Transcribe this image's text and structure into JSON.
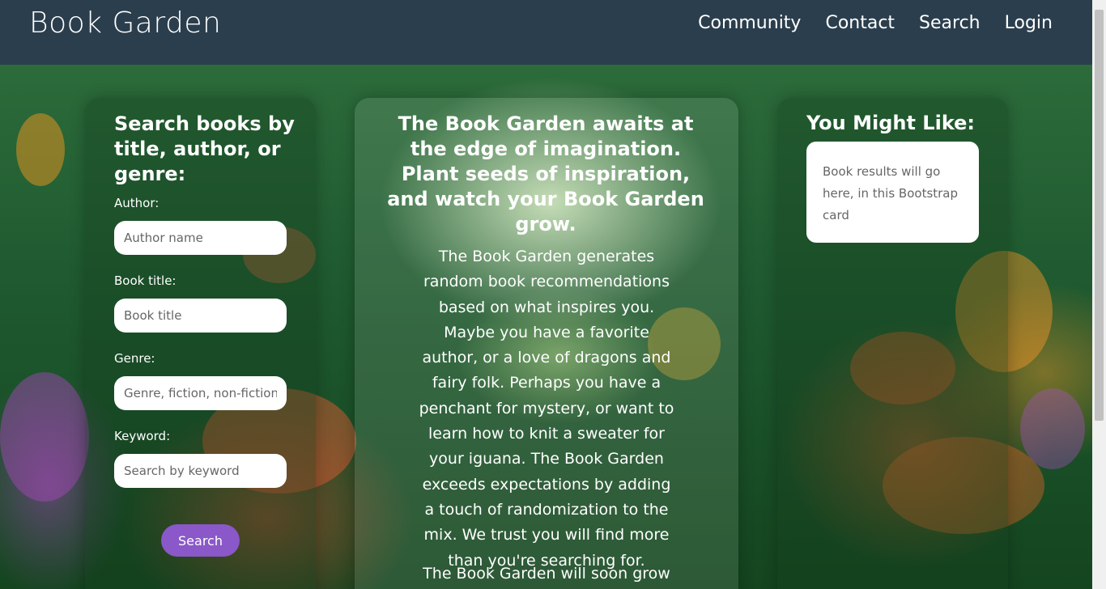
{
  "navbar": {
    "brand": "Book Garden",
    "links": [
      "Community",
      "Contact",
      "Search",
      "Login"
    ]
  },
  "search_form": {
    "title": "Search books by title, author, or genre:",
    "fields": [
      {
        "label": "Author:",
        "placeholder": "Author name"
      },
      {
        "label": "Book title:",
        "placeholder": "Book title"
      },
      {
        "label": "Genre:",
        "placeholder": "Genre, fiction, non-fiction, etc."
      },
      {
        "label": "Keyword:",
        "placeholder": "Search by keyword"
      }
    ],
    "button_label": "Search"
  },
  "main": {
    "headline": "The Book Garden awaits at the edge of imagination. Plant seeds of inspiration, and watch your Book Garden grow.",
    "paragraph": "The Book Garden generates random book recommendations based on what inspires you. Maybe you have a favorite author, or a love of dragons and fairy folk. Perhaps you have a penchant for mystery, or want to learn how to knit a sweater for your iguana. The Book Garden exceeds expectations by adding a touch of randomization to the mix. We trust you will find more than you're searching for.",
    "paragraph2": "The Book Garden will soon grow"
  },
  "recommendations": {
    "title": "You Might Like:",
    "card_text": "Book results will go here, in this Bootstrap card"
  },
  "colors": {
    "navbar": "#2b3e4d",
    "button": "#8a58c8"
  }
}
